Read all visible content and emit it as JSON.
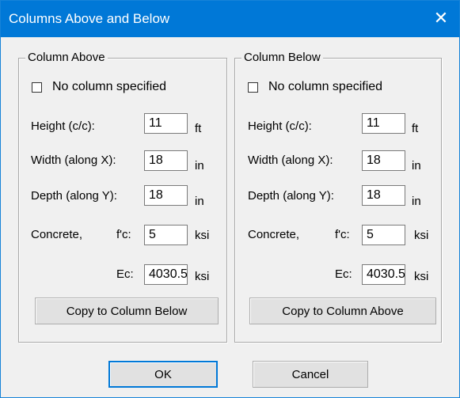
{
  "window": {
    "title": "Columns Above and Below",
    "close_glyph": "✕"
  },
  "above": {
    "legend": "Column Above",
    "no_column_label": "No column specified",
    "height": {
      "label": "Height (c/c):",
      "value": "11",
      "unit": "ft"
    },
    "width": {
      "label": "Width (along X):",
      "value": "18",
      "unit": "in"
    },
    "depth": {
      "label": "Depth (along Y):",
      "value": "18",
      "unit": "in"
    },
    "concrete": {
      "label": "Concrete,",
      "fc_label": "f'c:",
      "value": "5",
      "unit": "ksi"
    },
    "ec": {
      "label": "Ec:",
      "value": "4030.5",
      "unit": "ksi"
    },
    "copy_button": "Copy to Column Below"
  },
  "below": {
    "legend": "Column Below",
    "no_column_label": "No column specified",
    "height": {
      "label": "Height (c/c):",
      "value": "11",
      "unit": "ft"
    },
    "width": {
      "label": "Width (along X):",
      "value": "18",
      "unit": "in"
    },
    "depth": {
      "label": "Depth (along Y):",
      "value": "18",
      "unit": "in"
    },
    "concrete": {
      "label": "Concrete,",
      "fc_label": "f'c:",
      "value": "5",
      "unit": "ksi"
    },
    "ec": {
      "label": "Ec:",
      "value": "4030.5",
      "unit": "ksi"
    },
    "copy_button": "Copy to Column Above"
  },
  "buttons": {
    "ok": "OK",
    "cancel": "Cancel"
  },
  "colors": {
    "title_bar": "#0078d7",
    "dialog_bg": "#f0f0f0"
  }
}
